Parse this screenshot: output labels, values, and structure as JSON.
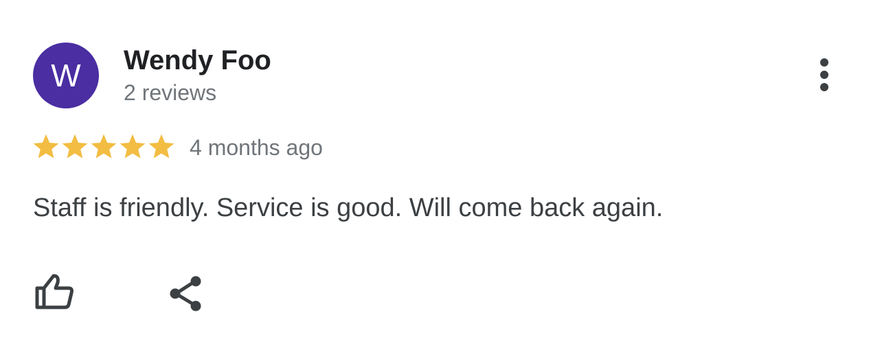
{
  "reviewer": {
    "initial": "W",
    "name": "Wendy Foo",
    "review_count": "2 reviews",
    "avatar_color": "#4a2ea2"
  },
  "review": {
    "rating": 5,
    "max_rating": 5,
    "star_color": "#f2bd42",
    "time_ago": "4 months ago",
    "text": "Staff is friendly. Service is good. Will come back again."
  },
  "icons": {
    "more": "more-vert-icon",
    "like": "thumb-up-icon",
    "share": "share-icon"
  },
  "colors": {
    "icon": "#3c4043",
    "secondary_text": "#70757a"
  }
}
